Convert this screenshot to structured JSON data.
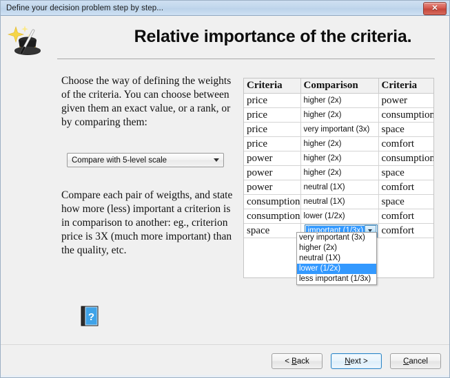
{
  "window": {
    "title": "Define your decision problem step by step...",
    "close_label": "✕"
  },
  "header": {
    "page_title": "Relative importance of the criteria.",
    "icon": "magic-hat-icon"
  },
  "left": {
    "intro_text": "Choose the way of defining the weights of the criteria. You can choose between given them an exact value, or a rank, or by comparing them:",
    "method_combo": {
      "value": "Compare with 5-level scale",
      "arrow": "chevron-down-icon"
    },
    "explain_text": "Compare each pair of weigths, and state how more (less) important a criterion is in comparison to another: eg., criterion price is 3X (much more important)  than the quality, etc.",
    "help_icon": "help-book-icon"
  },
  "table": {
    "headers": [
      "Criteria",
      "Comparison",
      "Criteria"
    ],
    "rows": [
      {
        "left": "price",
        "comparison": "higher (2x)",
        "right": "power"
      },
      {
        "left": "price",
        "comparison": "higher (2x)",
        "right": "consumption"
      },
      {
        "left": "price",
        "comparison": "very important (3x)",
        "right": "space"
      },
      {
        "left": "price",
        "comparison": "higher (2x)",
        "right": "comfort"
      },
      {
        "left": "power",
        "comparison": "higher (2x)",
        "right": "consumption"
      },
      {
        "left": "power",
        "comparison": "higher (2x)",
        "right": "space"
      },
      {
        "left": "power",
        "comparison": "neutral (1X)",
        "right": "comfort"
      },
      {
        "left": "consumption",
        "comparison": "neutral (1X)",
        "right": "space"
      },
      {
        "left": "consumption",
        "comparison": "lower (1/2x)",
        "right": "comfort"
      },
      {
        "left": "space",
        "comparison": "important (1/3x)",
        "right": "comfort",
        "editing": true
      }
    ],
    "editor": {
      "value": "important (1/3x)",
      "arrow": "chevron-down-icon"
    }
  },
  "dropdown": {
    "options": [
      "very important (3x)",
      "higher (2x)",
      "neutral (1X)",
      "lower (1/2x)",
      "less important (1/3x)"
    ],
    "selected_index": 3
  },
  "footer": {
    "back": {
      "pre": "< ",
      "accel": "B",
      "post": "ack"
    },
    "next": {
      "pre": "",
      "accel": "N",
      "post": "ext >"
    },
    "cancel": {
      "pre": "",
      "accel": "C",
      "post": "ancel"
    }
  },
  "colors": {
    "highlight": "#3399ff",
    "title_bar": "#c2d7ec",
    "close_red": "#c4453a"
  }
}
